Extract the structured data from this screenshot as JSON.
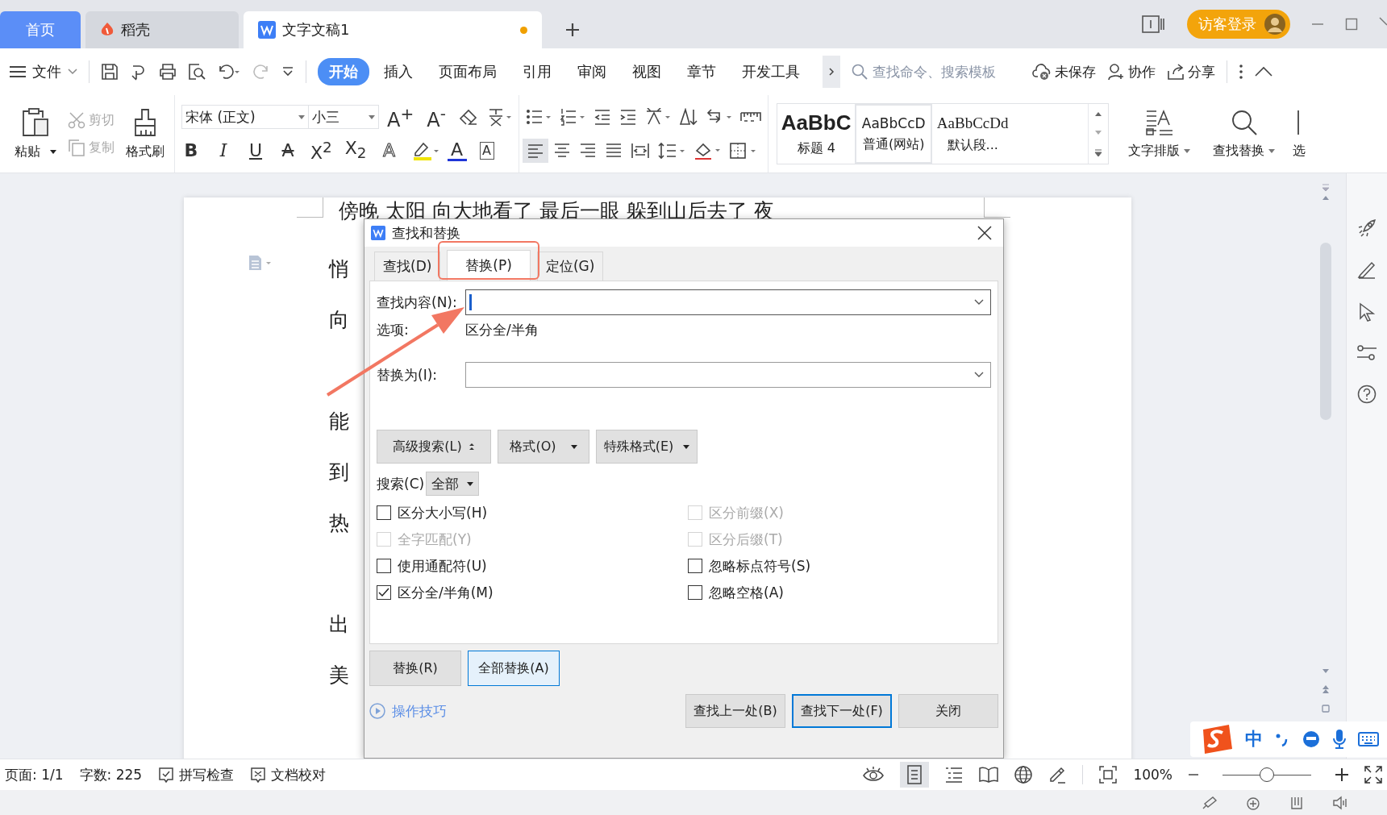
{
  "tabs": [
    {
      "label": "首页",
      "kind": "home",
      "selected": false
    },
    {
      "label": "稻壳",
      "kind": "app",
      "selected": false
    },
    {
      "label": "文字文稿1",
      "kind": "doc",
      "selected": true,
      "unsaved": true
    }
  ],
  "login_button": "访客登录",
  "menu": {
    "file": "文件",
    "ribbon_tabs": [
      {
        "label": "开始",
        "selected": true
      },
      {
        "label": "插入",
        "selected": false
      },
      {
        "label": "页面布局",
        "selected": false
      },
      {
        "label": "引用",
        "selected": false
      },
      {
        "label": "审阅",
        "selected": false
      },
      {
        "label": "视图",
        "selected": false
      },
      {
        "label": "章节",
        "selected": false
      },
      {
        "label": "开发工具",
        "selected": false
      }
    ],
    "search_placeholder": "查找命令、搜索模板",
    "actions": [
      {
        "label": "未保存",
        "kind": "cloud"
      },
      {
        "label": "协作",
        "kind": "user"
      },
      {
        "label": "分享",
        "kind": "share"
      }
    ]
  },
  "toolbar": {
    "paste": "粘贴",
    "cut": {
      "label": "剪切",
      "disabled": true
    },
    "copy": {
      "label": "复制",
      "disabled": true
    },
    "format_painter": "格式刷",
    "font": "宋体 (正文)",
    "size": "小三",
    "grow": "A$^{+}$",
    "shrink": "A$^{-}$",
    "format_buttons": [
      {
        "glyph": "B",
        "kind": "bold"
      },
      {
        "glyph": "I",
        "kind": "italic"
      },
      {
        "glyph": "U",
        "kind": "underline"
      },
      {
        "glyph": "A",
        "kind": "strike"
      },
      {
        "glyph": "X$^{2}$",
        "kind": "plain"
      },
      {
        "glyph": "X$_{2}$",
        "kind": "plain"
      },
      {
        "glyph": "A",
        "kind": "outline"
      },
      {
        "kind": "highlight"
      },
      {
        "glyph": "A",
        "kind": "color"
      },
      {
        "glyph": "A",
        "kind": "boxed"
      }
    ],
    "styles": [
      {
        "preview": "AaBbC",
        "name": "标题 4",
        "kind": "heading",
        "selected": false
      },
      {
        "preview": "AaBbCcD",
        "name": "普通(网站)",
        "kind": "normal",
        "selected": true
      },
      {
        "preview": "AaBbCcDd",
        "name": "默认段...",
        "kind": "serif",
        "selected": false
      }
    ],
    "text_layout": "文字排版",
    "find_replace": "查找替换",
    "select": "选"
  },
  "document": {
    "first_line": "傍晚 太阳 向大地看了 最后一眼 躲到山后去了 夜",
    "lines": [
      "悄",
      "向",
      "能",
      "到",
      "热",
      "出",
      "美"
    ]
  },
  "dialog": {
    "title": "查找和替换",
    "tabs": [
      {
        "label": "查找(D)",
        "selected": false
      },
      {
        "label": "替换(P)",
        "selected": true
      },
      {
        "label": "定位(G)",
        "selected": false
      }
    ],
    "find_label": "查找内容(N):",
    "options_label": "选项:",
    "options_value": "区分全/半角",
    "replace_label": "替换为(I):",
    "option_buttons": [
      "高级搜索(L)",
      "格式(O)",
      "特殊格式(E)"
    ],
    "search_label": "搜索(C)",
    "search_value": "全部",
    "checkboxes": [
      {
        "label": "区分大小写(H)",
        "checked": false,
        "disabled": false
      },
      {
        "label": "区分前缀(X)",
        "checked": false,
        "disabled": true
      },
      {
        "label": "全字匹配(Y)",
        "checked": false,
        "disabled": true
      },
      {
        "label": "区分后缀(T)",
        "checked": false,
        "disabled": true
      },
      {
        "label": "使用通配符(U)",
        "checked": false,
        "disabled": false
      },
      {
        "label": "忽略标点符号(S)",
        "checked": false,
        "disabled": false
      },
      {
        "label": "区分全/半角(M)",
        "checked": true,
        "disabled": false
      },
      {
        "label": "忽略空格(A)",
        "checked": false,
        "disabled": false
      }
    ],
    "replace_buttons": [
      {
        "label": "替换(R)",
        "selected": false
      },
      {
        "label": "全部替换(A)",
        "selected": true
      }
    ],
    "tips_link": "操作技巧",
    "footer_buttons": [
      {
        "label": "查找上一处(B)",
        "selected": false
      },
      {
        "label": "查找下一处(F)",
        "selected": true
      },
      {
        "label": "关闭",
        "selected": false
      }
    ]
  },
  "status_bar": {
    "page": "页面: 1/1",
    "words": "字数: 225",
    "spell_check": "拼写检查",
    "proofread": "文档校对",
    "zoom": "100%",
    "zoom_slider": {
      "level": 0.5
    }
  },
  "ime_bar": {
    "mode": "中"
  }
}
